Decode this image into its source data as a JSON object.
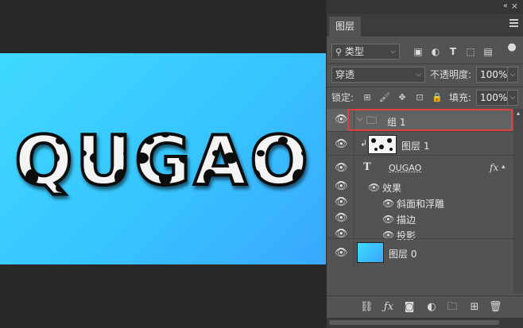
{
  "canvas": {
    "text": "QUGAO",
    "background_color": "#3ecbff"
  },
  "panel": {
    "collapse_icon": "«",
    "close_icon": "×",
    "tab_label": "图层",
    "filter_label": "类型",
    "blend_mode": "穿透",
    "opacity_label": "不透明度:",
    "opacity_value": "100%",
    "lock_label": "锁定:",
    "fill_label": "填充:",
    "fill_value": "100%"
  },
  "layers": [
    {
      "name": "组 1",
      "type": "group",
      "selected": true
    },
    {
      "name": "图层 1",
      "type": "clipped-pixel"
    },
    {
      "name": "QUGAO",
      "type": "text",
      "fx": "fx"
    },
    {
      "name": "效果",
      "type": "effects-header"
    },
    {
      "name": "斜面和浮雕",
      "type": "effect"
    },
    {
      "name": "描边",
      "type": "effect"
    },
    {
      "name": "投影",
      "type": "effect"
    },
    {
      "name": "图层 0",
      "type": "pixel"
    }
  ],
  "colors": {
    "selection_outline": "#e04040",
    "panel_bg": "#535353",
    "dark_bg": "#282828"
  }
}
